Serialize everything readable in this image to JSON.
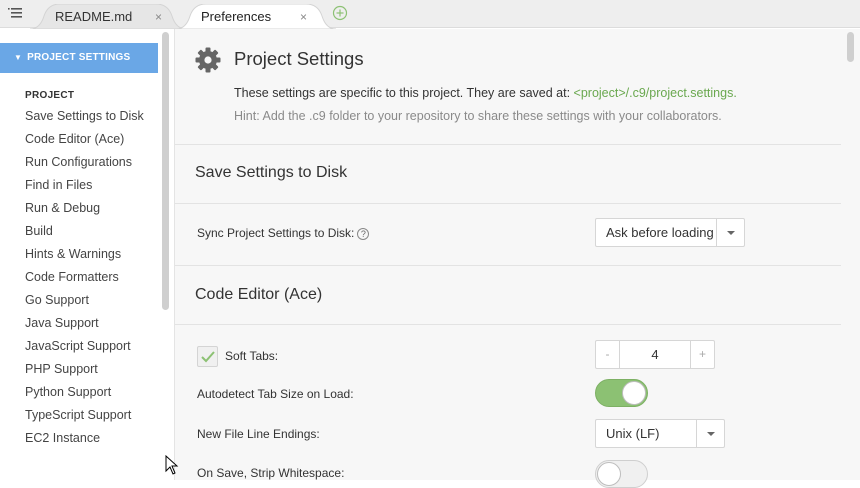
{
  "tabs": [
    {
      "label": "README.md",
      "close": "×"
    },
    {
      "label": "Preferences",
      "close": "×"
    }
  ],
  "sidebar": {
    "header": "PROJECT SETTINGS",
    "group": "PROJECT",
    "items": [
      "Save Settings to Disk",
      "Code Editor (Ace)",
      "Run Configurations",
      "Find in Files",
      "Run & Debug",
      "Build",
      "Hints & Warnings",
      "Code Formatters",
      "Go Support",
      "Java Support",
      "JavaScript Support",
      "PHP Support",
      "Python Support",
      "TypeScript Support",
      "EC2 Instance"
    ]
  },
  "main": {
    "title": "Project Settings",
    "intro_text": "These settings are specific to this project. They are saved at: ",
    "intro_path": "<project>/.c9/project.settings.",
    "hint": "Hint: Add the .c9 folder to your repository to share these settings with your collaborators.",
    "sections": {
      "save_disk": {
        "title": "Save Settings to Disk",
        "sync_label": "Sync Project Settings to Disk:",
        "sync_help": "?",
        "sync_value": "Ask before loading"
      },
      "code_editor": {
        "title": "Code Editor (Ace)",
        "soft_tabs_label": "Soft Tabs:",
        "soft_tabs_checked": true,
        "tab_size": "4",
        "stepper_minus": "-",
        "stepper_plus": "+",
        "autodetect_label": "Autodetect Tab Size on Load:",
        "autodetect_on": true,
        "line_endings_label": "New File Line Endings:",
        "line_endings_value": "Unix (LF)",
        "strip_ws_label": "On Save, Strip Whitespace:",
        "strip_ws_on": false
      }
    }
  },
  "colors": {
    "accent": "#6aa7e6",
    "toggle_on": "#8cc173",
    "path_green": "#6aa84f"
  }
}
